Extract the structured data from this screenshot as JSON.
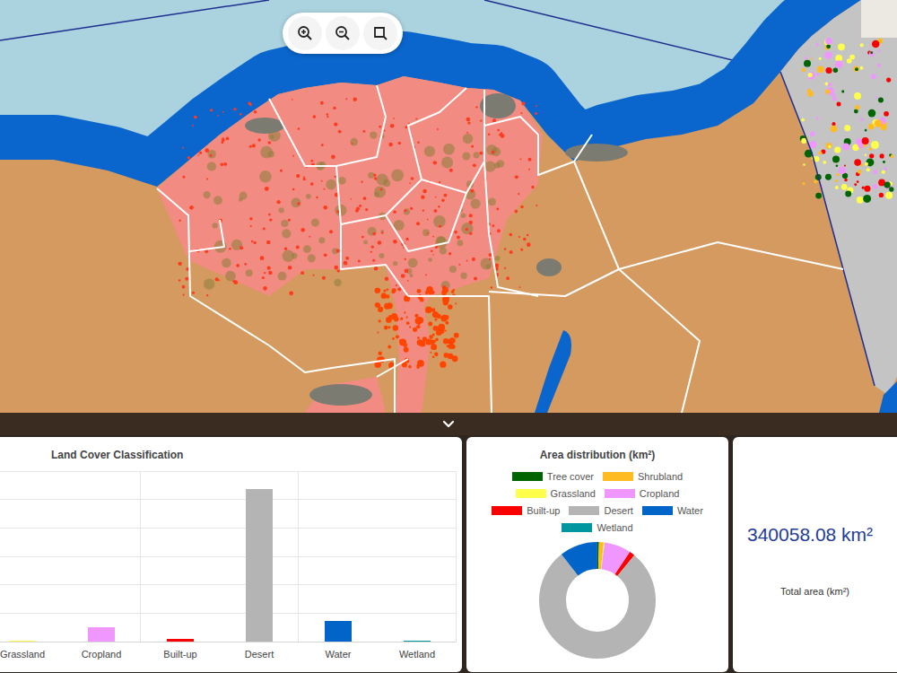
{
  "panel": {
    "expanded": true
  },
  "bar_chart": {
    "title": "Land Cover Classification",
    "bars": [
      {
        "label": "Grassland",
        "value": 800,
        "color": "#ffff4c"
      },
      {
        "label": "Cropland",
        "value": 25200,
        "color": "#f096ff"
      },
      {
        "label": "Built-up",
        "value": 5100,
        "color": "#fa0000"
      },
      {
        "label": "Desert",
        "value": 266500,
        "color": "#b4b4b4"
      },
      {
        "label": "Water",
        "value": 35900,
        "color": "#0064c8"
      },
      {
        "label": "Wetland",
        "value": 600,
        "color": "#0096a0"
      }
    ]
  },
  "area_distribution": {
    "title": "Area distribution (km²)",
    "legend": [
      {
        "label": "Tree cover",
        "color": "#006400"
      },
      {
        "label": "Shrubland",
        "color": "#ffbb22"
      },
      {
        "label": "Grassland",
        "color": "#ffff4c"
      },
      {
        "label": "Cropland",
        "color": "#f096ff"
      },
      {
        "label": "Built-up",
        "color": "#fa0000"
      },
      {
        "label": "Desert",
        "color": "#b4b4b4"
      },
      {
        "label": "Water",
        "color": "#0064c8"
      },
      {
        "label": "Wetland",
        "color": "#0096a0"
      }
    ],
    "values": [
      1500,
      4500,
      800,
      25200,
      5100,
      266500,
      35900,
      600
    ]
  },
  "total": {
    "value": "340058.08 km²",
    "label": "Total area (km²)"
  }
}
